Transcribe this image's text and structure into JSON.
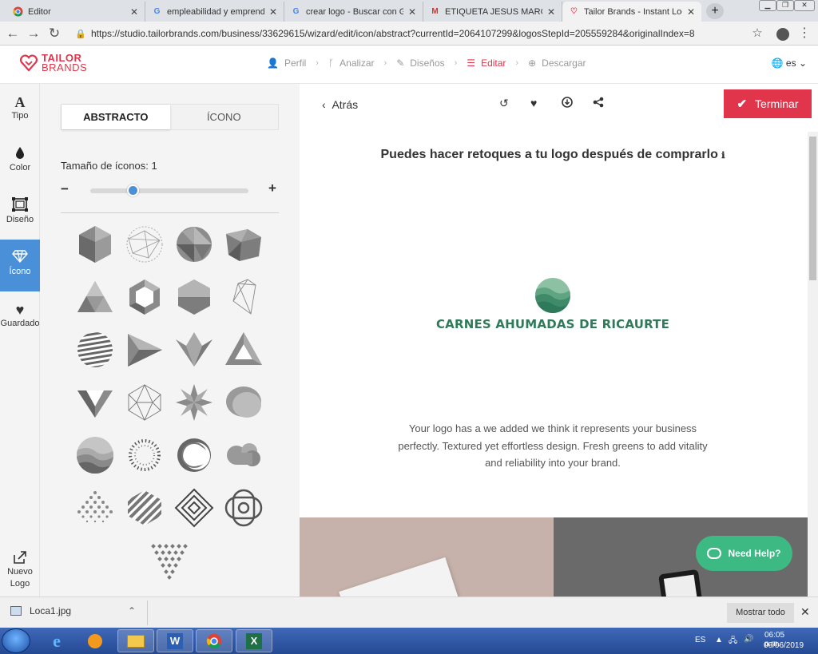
{
  "browser": {
    "tabs": [
      {
        "title": "Editor",
        "icon": "chrome-icon"
      },
      {
        "title": "empleabilidad y emprendimiento",
        "icon": "google-icon"
      },
      {
        "title": "crear logo - Buscar con Google",
        "icon": "google-icon"
      },
      {
        "title": "ETIQUETA JESUS MARCILLO",
        "icon": "gmail-icon"
      },
      {
        "title": "Tailor Brands - Instant Logo",
        "icon": "tailor-icon"
      }
    ],
    "new_tab": "+",
    "url": "https://studio.tailorbrands.com/business/33629615/wizard/edit/icon/abstract?currentId=2064107299&logosStepId=205559284&originalIndex=8"
  },
  "app": {
    "brand_line1": "TAILOR",
    "brand_line2": "BRANDS",
    "steps": [
      {
        "label": "Perfil",
        "icon": "person-icon"
      },
      {
        "label": "Analizar",
        "icon": "branch-icon"
      },
      {
        "label": "Diseños",
        "icon": "pen-icon"
      },
      {
        "label": "Editar",
        "icon": "sliders-icon"
      },
      {
        "label": "Descargar",
        "icon": "download-icon"
      }
    ],
    "active_step": "Editar",
    "language": "es"
  },
  "rail": [
    {
      "label": "Tipo",
      "icon": "type-icon",
      "glyph": "A"
    },
    {
      "label": "Color",
      "icon": "drop-icon",
      "glyph": "💧"
    },
    {
      "label": "Diseño",
      "icon": "layout-icon",
      "glyph": "▣"
    },
    {
      "label": "Ícono",
      "icon": "diamond-icon",
      "glyph": "◇"
    },
    {
      "label": "Guardado",
      "icon": "heart-icon",
      "glyph": "♥"
    }
  ],
  "rail_bottom": {
    "line1": "Nuevo",
    "line2": "Logo",
    "icon": "new-logo-icon"
  },
  "panel": {
    "tabs": [
      "ABSTRACTO",
      "ÍCONO"
    ],
    "active_tab": "ABSTRACTO",
    "size_label": "Tamaño de íconos: 1",
    "slider_fraction": 0.25,
    "minus": "−",
    "plus": "+"
  },
  "canvas": {
    "back": "Atrás",
    "finish": "Terminar",
    "headline": "Puedes hacer retoques a tu logo después de comprarlo",
    "logo_name": "CARNES AHUMADAS DE RICAURTE",
    "description": "Your logo has a we added we think it represents your business perfectly. Textured yet effortless design. Fresh greens to add vitality and reliability into your brand.",
    "help": "Need Help?"
  },
  "downloads": {
    "file": "Loca1.jpg",
    "show_all": "Mostrar todo"
  },
  "taskbar": {
    "lang": "ES",
    "time": "06:05 p.m.",
    "date": "06/06/2019"
  },
  "colors": {
    "accent": "#e0354b",
    "active_blue": "#4a90d9",
    "logo_green": "#2f7a5a",
    "help_green": "#3dba83"
  }
}
